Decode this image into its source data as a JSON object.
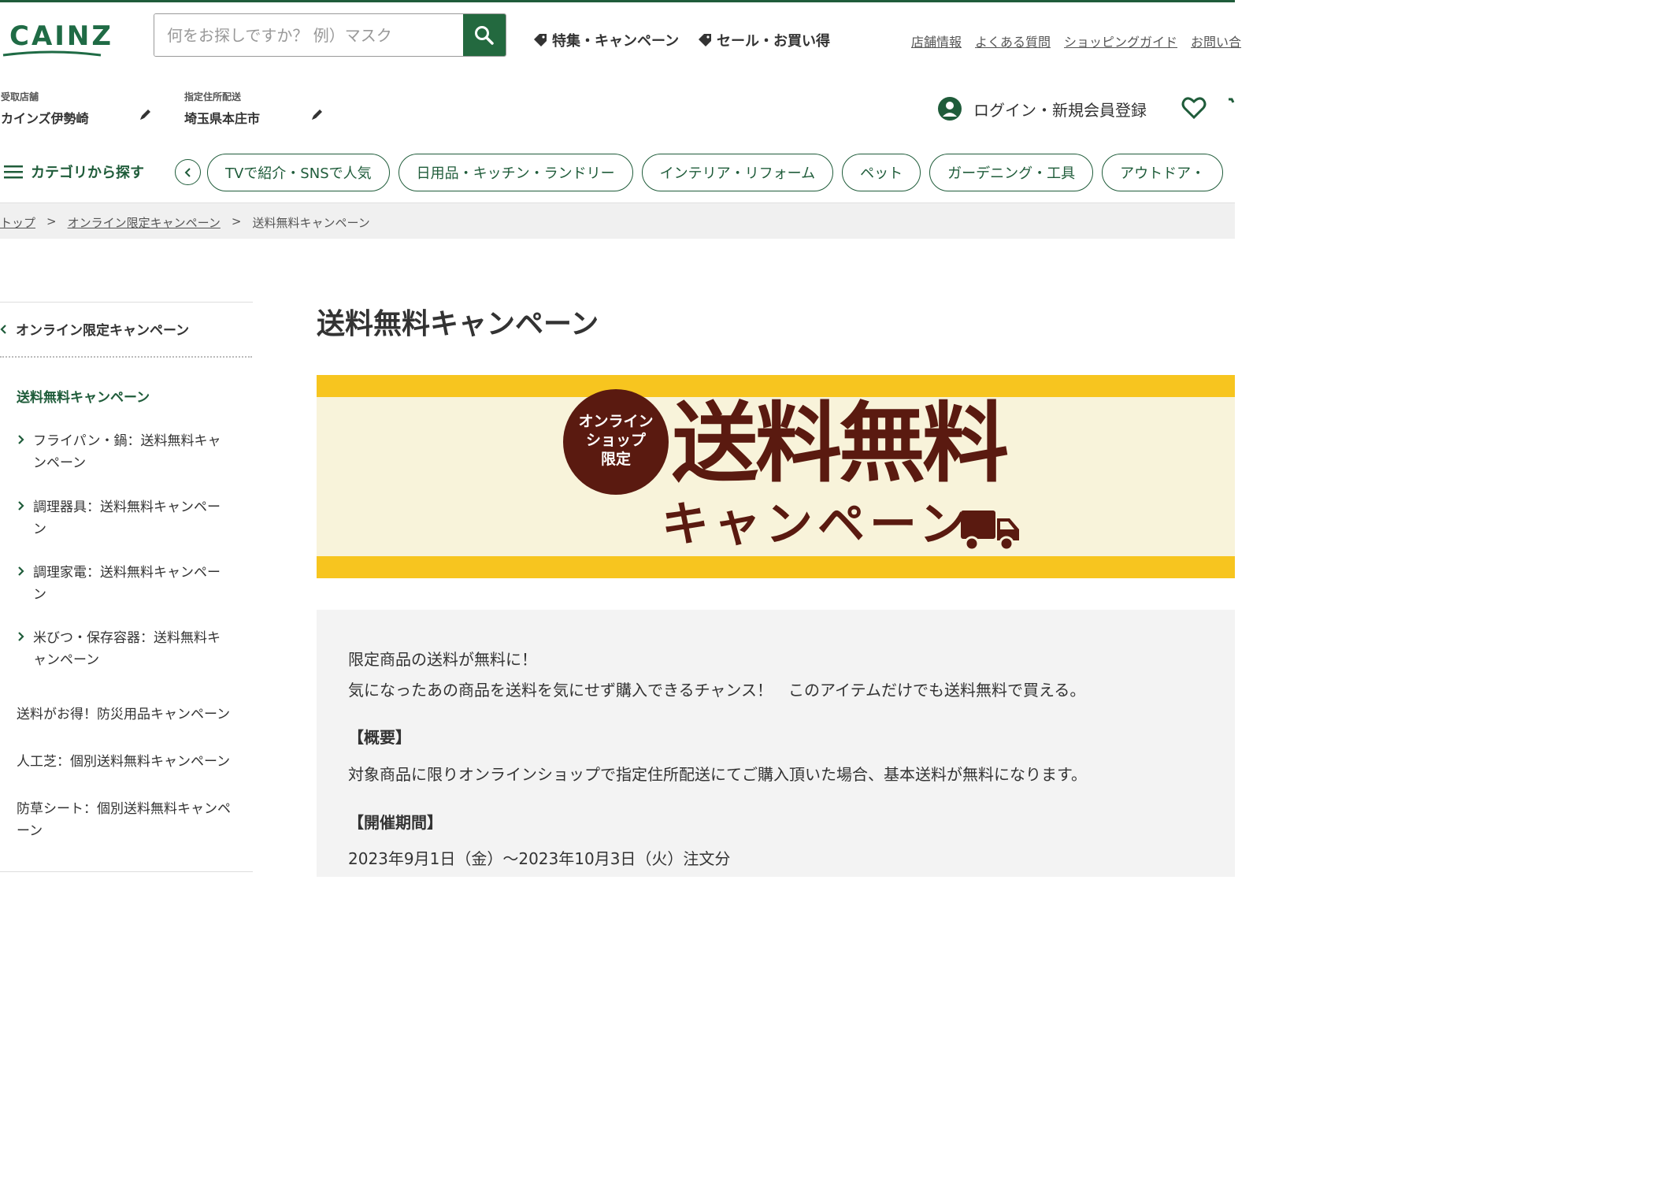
{
  "brand": {
    "logo": "CAINZ",
    "accent": "#1f5c3a"
  },
  "search": {
    "placeholder": "何をお探しですか？ 例）マスク"
  },
  "header": {
    "promo1": "特集・キャンペーン",
    "promo2": "セール・お買い得",
    "links": [
      "店舗情報",
      "よくある質問",
      "ショッピングガイド",
      "お問い合"
    ]
  },
  "store": {
    "label": "受取店舗",
    "value": "カインズ伊勢崎"
  },
  "delivery": {
    "label": "指定住所配送",
    "value": "埼玉県本庄市"
  },
  "account": {
    "login": "ログイン・新規会員登録"
  },
  "categories": {
    "menu_label": "カテゴリから探す",
    "pills": [
      "TVで紹介・SNSで人気",
      "日用品・キッチン・ランドリー",
      "インテリア・リフォーム",
      "ペット",
      "ガーデニング・工具",
      "アウトドア・"
    ]
  },
  "breadcrumb": {
    "home": "トップ",
    "parent": "オンライン限定キャンペーン",
    "current": "送料無料キャンペーン",
    "sep": ">"
  },
  "sidebar": {
    "back": "オンライン限定キャンペーン",
    "current": "送料無料キャンペーン",
    "subitems": [
      {
        "line1": "フライパン・鍋：送料無料キャ",
        "line2": "ンペーン"
      },
      {
        "line1": "調理器具：送料無料キャンペー",
        "line2": "ン"
      },
      {
        "line1": "調理家電：送料無料キャンペー",
        "line2": "ン"
      },
      {
        "line1": "米びつ・保存容器：送料無料キ",
        "line2": "ャンペーン"
      }
    ],
    "others": [
      {
        "line1": "送料がお得！防災用品キャンペーン",
        "line2": ""
      },
      {
        "line1": "人工芝：個別送料無料キャンペーン",
        "line2": ""
      },
      {
        "line1": "防草シート：個別送料無料キャンペ",
        "line2": "ーン"
      }
    ]
  },
  "main": {
    "title": "送料無料キャンペーン",
    "banner": {
      "seal_lines": [
        "オンライン",
        "ショップ",
        "限定"
      ],
      "headline": "送料無料",
      "subline": "キャンペーン",
      "colors": {
        "frame": "#f7c51f",
        "inner": "#f8f3da",
        "ink": "#5a1a10"
      }
    },
    "intro1": "限定商品の送料が無料に！",
    "intro2": "気になったあの商品を送料を気にせず購入できるチャンス！　このアイテムだけでも送料無料で買える。",
    "overview_heading": "【概要】",
    "overview_text": "対象商品に限りオンラインショップで指定住所配送にてご購入頂いた場合、基本送料が無料になります。",
    "period_heading": "【開催期間】",
    "period_text": "2023年9月1日（金）～2023年10月3日（火）注文分"
  },
  "icons": [
    "search-icon",
    "tag-icon",
    "pencil-icon",
    "user-icon",
    "heart-icon",
    "menu-icon",
    "chevron-left-icon",
    "chevron-right-icon",
    "truck-icon"
  ]
}
